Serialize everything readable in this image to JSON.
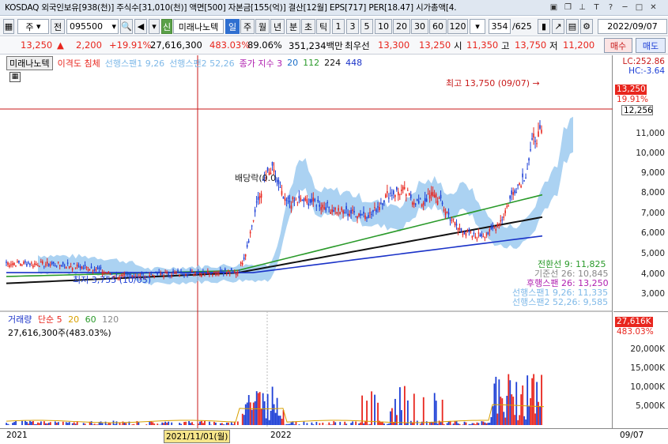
{
  "titlebar": {
    "text": "KOSDAQ 외국인보유[938(천)] 주식수[31,010(천)] 액면[500] 자본금[155(억)] 결산[12월] EPS[717] PER[18.47] 시가총액[4.",
    "icons": [
      "restore-icon",
      "copy-icon",
      "pin-icon",
      "text-icon",
      "help-icon",
      "minimize-icon",
      "maximize-icon",
      "close-icon"
    ]
  },
  "toolbar": {
    "market": "주",
    "prev": "전",
    "code": "095500",
    "company_badge": "신",
    "company": "미래나노텍",
    "periods": [
      "일",
      "주",
      "월",
      "년",
      "분",
      "초",
      "틱"
    ],
    "intervals": [
      "1",
      "3",
      "5",
      "10",
      "20",
      "30",
      "60",
      "120"
    ],
    "count": "354",
    "total": "/625",
    "date": "2022/09/07"
  },
  "pricebar": {
    "price": "13,250",
    "arrow": "▲",
    "change": "2,200",
    "rate": "+19.91%",
    "volume": "27,616,300",
    "vol_ratio": "483.03%",
    "other_ratio": "89.06%",
    "amount": "351,234백만",
    "ask_label": "최우선",
    "ask": "13,300",
    "bid": "13,250",
    "open_label": "시",
    "open": "11,350",
    "high_label": "고",
    "high": "13,750",
    "low_label": "저",
    "low": "11,200",
    "buy": "매수",
    "sell": "매도"
  },
  "legend": {
    "name": "미래나노텍",
    "ichimoku": "이격도 침체",
    "span1": "선행스팬1 9,26",
    "span2": "선행스팬2 52,26",
    "close_idx": "종가 지수 3",
    "ma1": "20",
    "ma2": "112",
    "ma3": "224",
    "ma4": "448"
  },
  "annotations": {
    "high": "최고 13,750 (09/07)",
    "low": "최저 3,755 (10/05)",
    "dividend": "배당락(0.0"
  },
  "ichimoku_values": {
    "conv": "전환선 9: 11,825",
    "base": "기준선 26: 10,845",
    "lag": "후행스팬 26: 13,250",
    "s1": "선행스팬1 9,26: 11,335",
    "s2": "선행스팬2 52,26: 9,585"
  },
  "axis": {
    "lc": "LC:252.86",
    "hc": "HC:-3.64",
    "price_tag": "13,250",
    "rate_tag": "19.91%",
    "line_tag": "12,256",
    "ticks": [
      "11,000",
      "10,000",
      "9,000",
      "8,000",
      "7,000",
      "6,000",
      "5,000",
      "4,000",
      "3,000"
    ],
    "vol_tag": "27,616K",
    "vol_rate_tag": "483.03%",
    "vol_ticks": [
      "20,000K",
      "15,000K",
      "10,000K",
      "5,000K"
    ]
  },
  "volume": {
    "label": "거래량",
    "simple": "단순 5",
    "ma20": "20",
    "ma60": "60",
    "ma120": "120",
    "value": "27,616,300주(483.03%)"
  },
  "xaxis": {
    "y2021": "2021",
    "cursor": "2021/11/01(월)",
    "y2022": "2022",
    "end": "09/07"
  },
  "colors": {
    "up": "#e8261e",
    "down": "#1d3fd6",
    "cloud": "#8fc3ee",
    "ma20": "#1a6ec8",
    "ma112": "#2a9a2a",
    "ma224": "#111111",
    "ma448": "#1a32c8"
  }
}
